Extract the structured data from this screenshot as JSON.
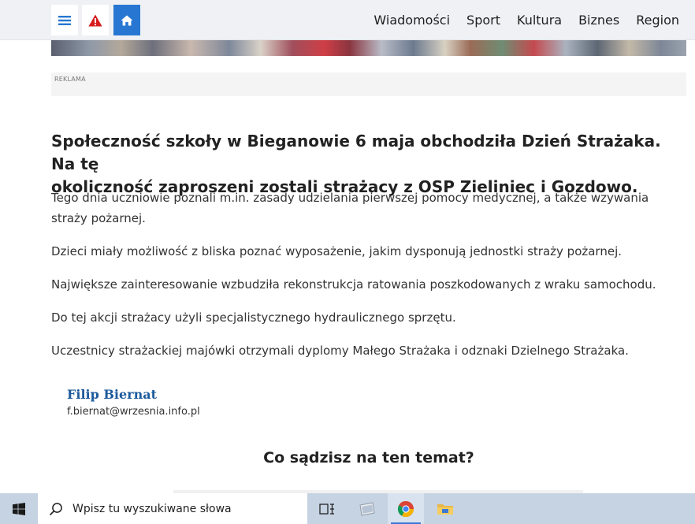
{
  "nav": {
    "menu_icon": "hamburger-icon",
    "alert_icon": "warning-icon",
    "home_icon": "home-icon",
    "links": [
      "Wiadomości",
      "Sport",
      "Kultura",
      "Biznes",
      "Region"
    ]
  },
  "ad": {
    "label": "REKLAMA"
  },
  "article": {
    "lead_line1": "Społeczność szkoły w Bieganowie 6 maja obchodziła Dzień Strażaka. Na tę",
    "lead_line2": "okoliczność zaproszeni zostali strażacy z OSP Zieliniec i Gozdowo.",
    "paragraphs": [
      "Tego dnia uczniowie poznali m.in. zasady udzielania pierwszej pomocy medycznej, a także wzywania straży pożarnej.",
      "Dzieci miały możliwość z bliska poznać wyposażenie, jakim dysponują jednostki straży pożarnej.",
      "Największe zainteresowanie wzbudziła rekonstrukcja ratowania poszkodowanych z wraku samochodu.",
      "Do tej akcji strażacy użyli specjalistycznego hydraulicznego sprzętu.",
      "Uczestnicy strażackiej majówki otrzymali dyplomy Małego Strażaka i odznaki Dzielnego Strażaka."
    ]
  },
  "author": {
    "name": "Filip Biernat",
    "email": "f.biernat@wrzesnia.info.pl"
  },
  "comments": {
    "heading": "Co sądzisz na ten temat?"
  },
  "taskbar": {
    "search_placeholder": "Wpisz tu wyszukiwane słowa",
    "colors": {
      "taskbar": "#c6d3e3",
      "accent": "#2777d2",
      "author": "#1d5a9c"
    }
  }
}
